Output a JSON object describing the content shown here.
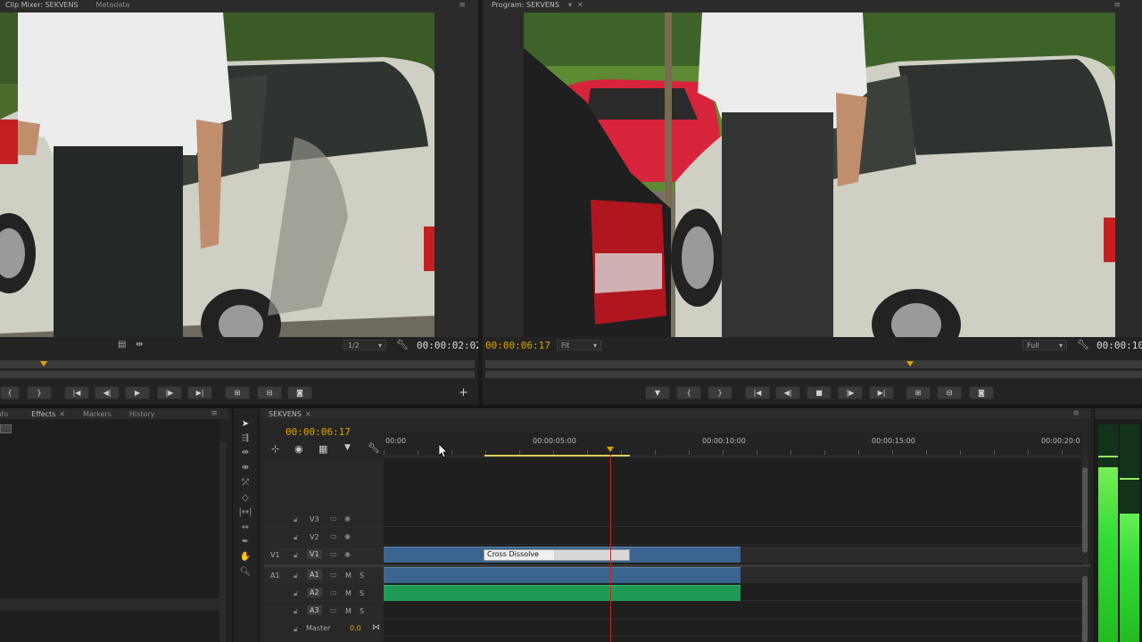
{
  "source_monitor": {
    "tabs": [
      "Clip Mixer: SEKVENS",
      "Metadata"
    ],
    "zoom": "1/2",
    "timecode": "00:00:02:02"
  },
  "program_monitor": {
    "tab": "Program: SEKVENS",
    "timecode_current": "00:00:06:17",
    "fit": "Fit",
    "quality": "Full",
    "timecode_duration": "00:00:10"
  },
  "bottom_left": {
    "tabs": [
      "Info",
      "Effects",
      "Markers",
      "History"
    ],
    "active": "Effects"
  },
  "timeline": {
    "tab": "SEKVENS",
    "timecode": "00:00:06:17",
    "ruler": [
      "00:00",
      "00:00:05:00",
      "00:00:10:00",
      "00:00:15:00",
      "00:00:20:0"
    ],
    "tracks": {
      "v3": "V3",
      "v2": "V2",
      "v1": "V1",
      "v1_src": "V1",
      "a1": "A1",
      "a1_src": "A1",
      "a2": "A2",
      "a3": "A3",
      "master": "Master",
      "master_val": "0,0",
      "m": "M",
      "s": "S"
    },
    "transition_label": "Cross Dissolve"
  },
  "colors": {
    "accent_timecode": "#e0a200",
    "video_clip": "#3b6590",
    "audio_clip_a2": "#1f9a55",
    "playhead": "#c4281b",
    "meter": "#33dd33"
  }
}
